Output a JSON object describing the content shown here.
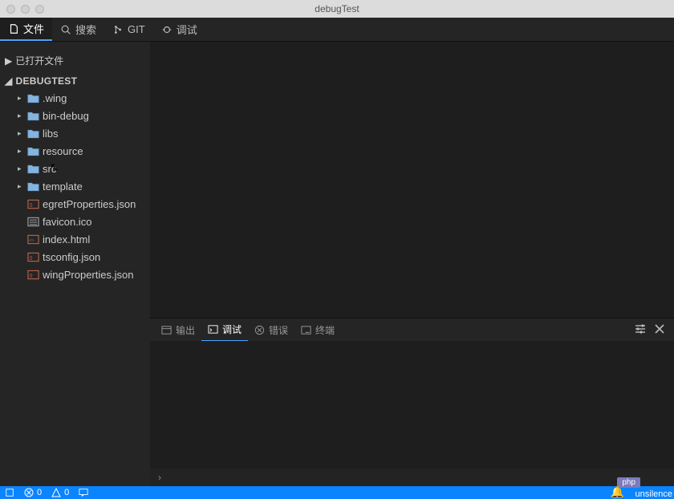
{
  "window": {
    "title": "debugTest"
  },
  "toolbar": {
    "tabs": [
      {
        "id": "file",
        "label": "文件",
        "active": true
      },
      {
        "id": "search",
        "label": "搜索",
        "active": false
      },
      {
        "id": "git",
        "label": "GIT",
        "active": false
      },
      {
        "id": "debug",
        "label": "调试",
        "active": false
      }
    ]
  },
  "sidebar": {
    "opened_files": {
      "label": "已打开文件",
      "expanded": false
    },
    "project": {
      "label": "DEBUGTEST",
      "expanded": true,
      "folders": [
        {
          "name": ".wing"
        },
        {
          "name": "bin-debug"
        },
        {
          "name": "libs"
        },
        {
          "name": "resource"
        },
        {
          "name": "src"
        },
        {
          "name": "template"
        }
      ],
      "files": [
        {
          "name": "egretProperties.json",
          "kind": "json"
        },
        {
          "name": "favicon.ico",
          "kind": "ico"
        },
        {
          "name": "index.html",
          "kind": "html"
        },
        {
          "name": "tsconfig.json",
          "kind": "json"
        },
        {
          "name": "wingProperties.json",
          "kind": "json"
        }
      ]
    }
  },
  "panel": {
    "tabs": [
      {
        "id": "output",
        "label": "输出",
        "active": false
      },
      {
        "id": "debug",
        "label": "调试",
        "active": true
      },
      {
        "id": "errors",
        "label": "错误",
        "active": false
      },
      {
        "id": "terminal",
        "label": "终端",
        "active": false
      }
    ],
    "repl_prompt": "›"
  },
  "statusbar": {
    "errors": "0",
    "warnings": "0",
    "php_badge": "php",
    "unsilence": "unsilence"
  }
}
